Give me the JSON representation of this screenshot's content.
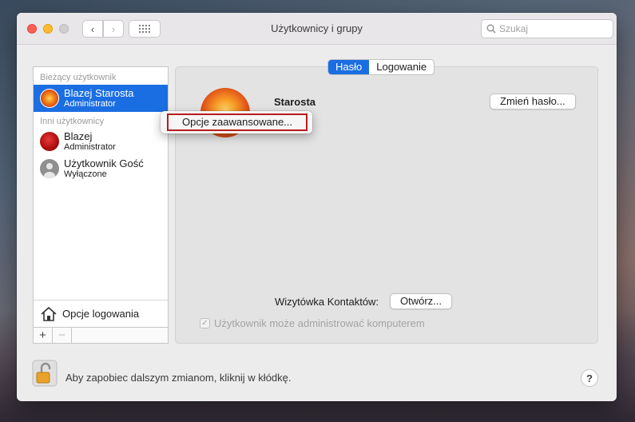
{
  "window": {
    "title": "Użytkownicy i grupy",
    "search_placeholder": "Szukaj"
  },
  "sidebar": {
    "current_section": "Bieżący użytkownik",
    "current_user": {
      "name": "Blazej Starosta",
      "role": "Administrator"
    },
    "other_section": "Inni użytkownicy",
    "other_users": [
      {
        "name": "Blazej",
        "role": "Administrator"
      },
      {
        "name": "Użytkownik Gość",
        "role": "Wyłączone"
      }
    ],
    "login_options": "Opcje logowania",
    "add": "+",
    "remove": "−"
  },
  "tabs": [
    {
      "label": "Hasło",
      "active": true
    },
    {
      "label": "Logowanie",
      "active": false
    }
  ],
  "main": {
    "user_heading": "Starosta",
    "change_password": "Zmień hasło...",
    "contact_card_label": "Wizytówka Kontaktów:",
    "open_button": "Otwórz...",
    "admin_checkbox": "Użytkownik może administrować komputerem",
    "admin_checked": true
  },
  "context_menu": {
    "item": "Opcje zaawansowane..."
  },
  "footer": {
    "lock_text": "Aby zapobiec dalszym zmianom, kliknij w kłódkę.",
    "help": "?"
  },
  "colors": {
    "accent": "#1b6ee2",
    "highlight_box": "#b81c1c"
  }
}
